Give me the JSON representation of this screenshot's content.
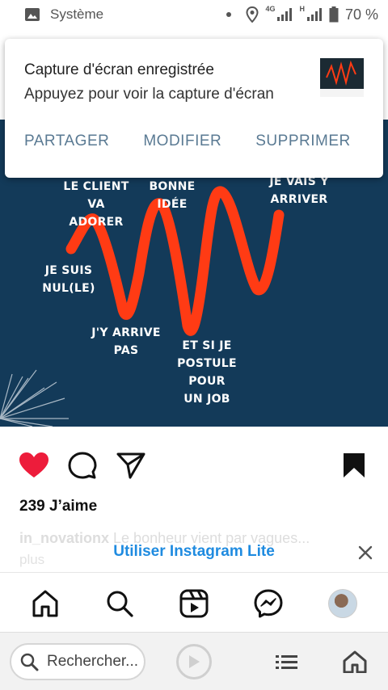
{
  "status_bar": {
    "app_label": "Système",
    "network": "4G",
    "network2": "H",
    "battery": "70 %"
  },
  "notification": {
    "title": "Capture d'écran enregistrée",
    "subtitle": "Appuyez pour voir la capture d'écran",
    "actions": {
      "share": "PARTAGER",
      "edit": "MODIFIER",
      "delete": "SUPPRIMER"
    }
  },
  "post_image": {
    "background": "#133a59",
    "wave_color": "#ff3b14",
    "labels": {
      "client": "LE CLIENT\nVA ADORER",
      "bonne_idee": "BONNE\nIDÉE",
      "vais_y_arriver": "JE VAIS Y\nARRIVER",
      "nul": "JE SUIS\nNUL(LE)",
      "arrive_pas": "J'Y ARRIVE\nPAS",
      "postule": "ET SI JE\nPOSTULE POUR\nUN JOB"
    }
  },
  "post": {
    "likes": "239 J’aime",
    "caption_user": "in_novationx",
    "caption_text": "Le bonheur vient par vagues...",
    "caption_more": "plus"
  },
  "banner": {
    "text": "Utiliser Instagram Lite"
  },
  "browser": {
    "search_placeholder": "Rechercher..."
  },
  "colors": {
    "like_red": "#ed1c3b",
    "link_blue": "#1f8be0",
    "notif_action": "#5a7a93"
  }
}
